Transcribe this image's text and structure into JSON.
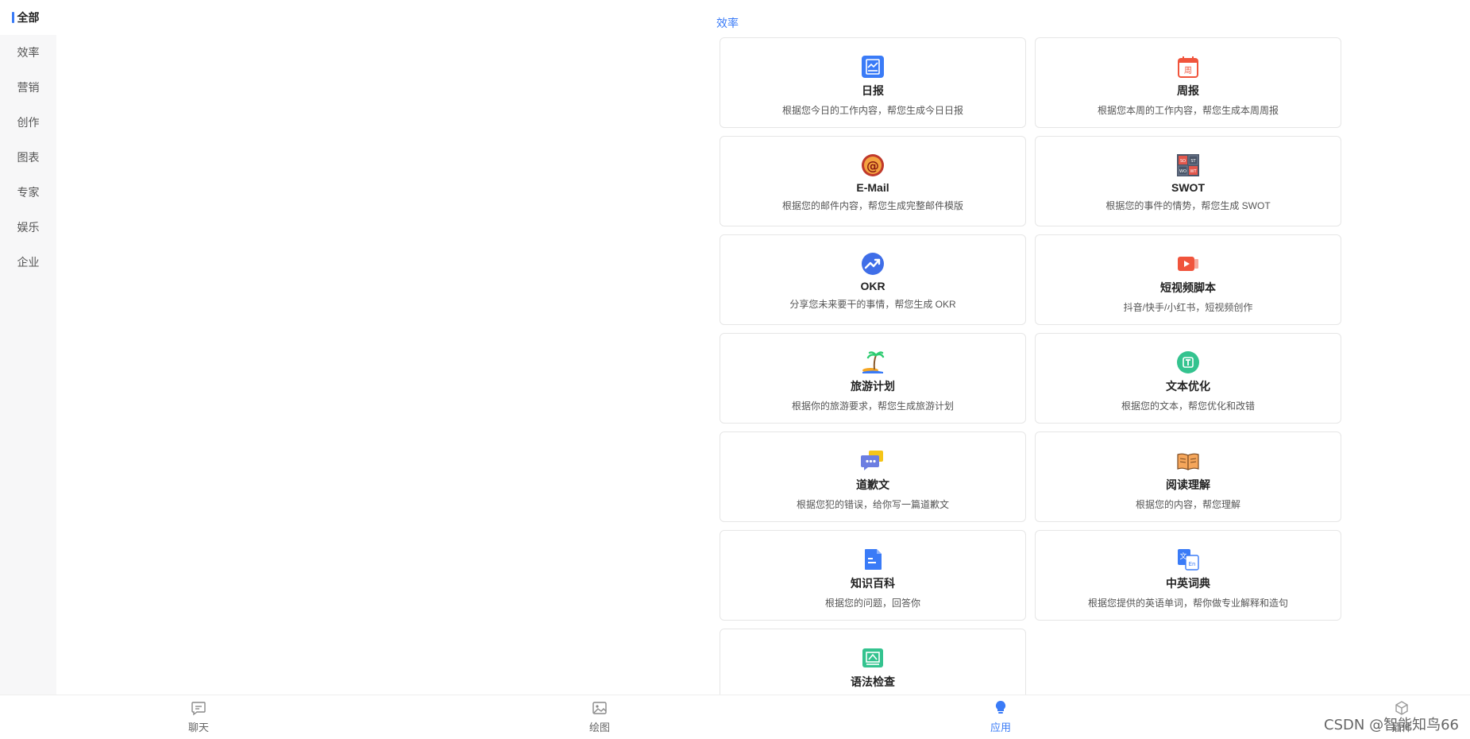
{
  "sidebar": {
    "items": [
      {
        "label": "全部",
        "active": true
      },
      {
        "label": "效率"
      },
      {
        "label": "营销"
      },
      {
        "label": "创作"
      },
      {
        "label": "图表"
      },
      {
        "label": "专家"
      },
      {
        "label": "娱乐"
      },
      {
        "label": "企业"
      }
    ]
  },
  "section": {
    "title": "效率"
  },
  "cards": [
    {
      "icon": "daily-report-icon",
      "title": "日报",
      "desc": "根据您今日的工作内容，帮您生成今日日报"
    },
    {
      "icon": "weekly-report-icon",
      "title": "周报",
      "desc": "根据您本周的工作内容，帮您生成本周周报"
    },
    {
      "icon": "email-icon",
      "title": "E-Mail",
      "desc": "根据您的邮件内容，帮您生成完整邮件模版"
    },
    {
      "icon": "swot-icon",
      "title": "SWOT",
      "desc": "根据您的事件的情势，帮您生成 SWOT"
    },
    {
      "icon": "okr-icon",
      "title": "OKR",
      "desc": "分享您未来要干的事情，帮您生成 OKR"
    },
    {
      "icon": "video-script-icon",
      "title": "短视频脚本",
      "desc": "抖音/快手/小红书，短视频创作"
    },
    {
      "icon": "travel-plan-icon",
      "title": "旅游计划",
      "desc": "根据你的旅游要求，帮您生成旅游计划"
    },
    {
      "icon": "text-optimize-icon",
      "title": "文本优化",
      "desc": "根据您的文本，帮您优化和改错"
    },
    {
      "icon": "apology-letter-icon",
      "title": "道歉文",
      "desc": "根据您犯的错误，给你写一篇道歉文"
    },
    {
      "icon": "reading-icon",
      "title": "阅读理解",
      "desc": "根据您的内容，帮您理解"
    },
    {
      "icon": "encyclopedia-icon",
      "title": "知识百科",
      "desc": "根据您的问题，回答你"
    },
    {
      "icon": "dictionary-icon",
      "title": "中英词典",
      "desc": "根据您提供的英语单词，帮你做专业解释和造句"
    },
    {
      "icon": "grammar-check-icon",
      "title": "语法检查",
      "desc": ""
    }
  ],
  "bottom_nav": [
    {
      "label": "聊天",
      "icon": "chat-icon"
    },
    {
      "label": "绘图",
      "icon": "image-icon"
    },
    {
      "label": "应用",
      "icon": "app-bulb-icon",
      "active": true
    },
    {
      "label": "插件",
      "icon": "plugin-cube-icon"
    }
  ],
  "watermark": "CSDN @智能知鸟66",
  "colors": {
    "accent": "#3a7bf7",
    "sidebar_bg": "#f7f7f8",
    "card_border": "#e6e6e6"
  }
}
